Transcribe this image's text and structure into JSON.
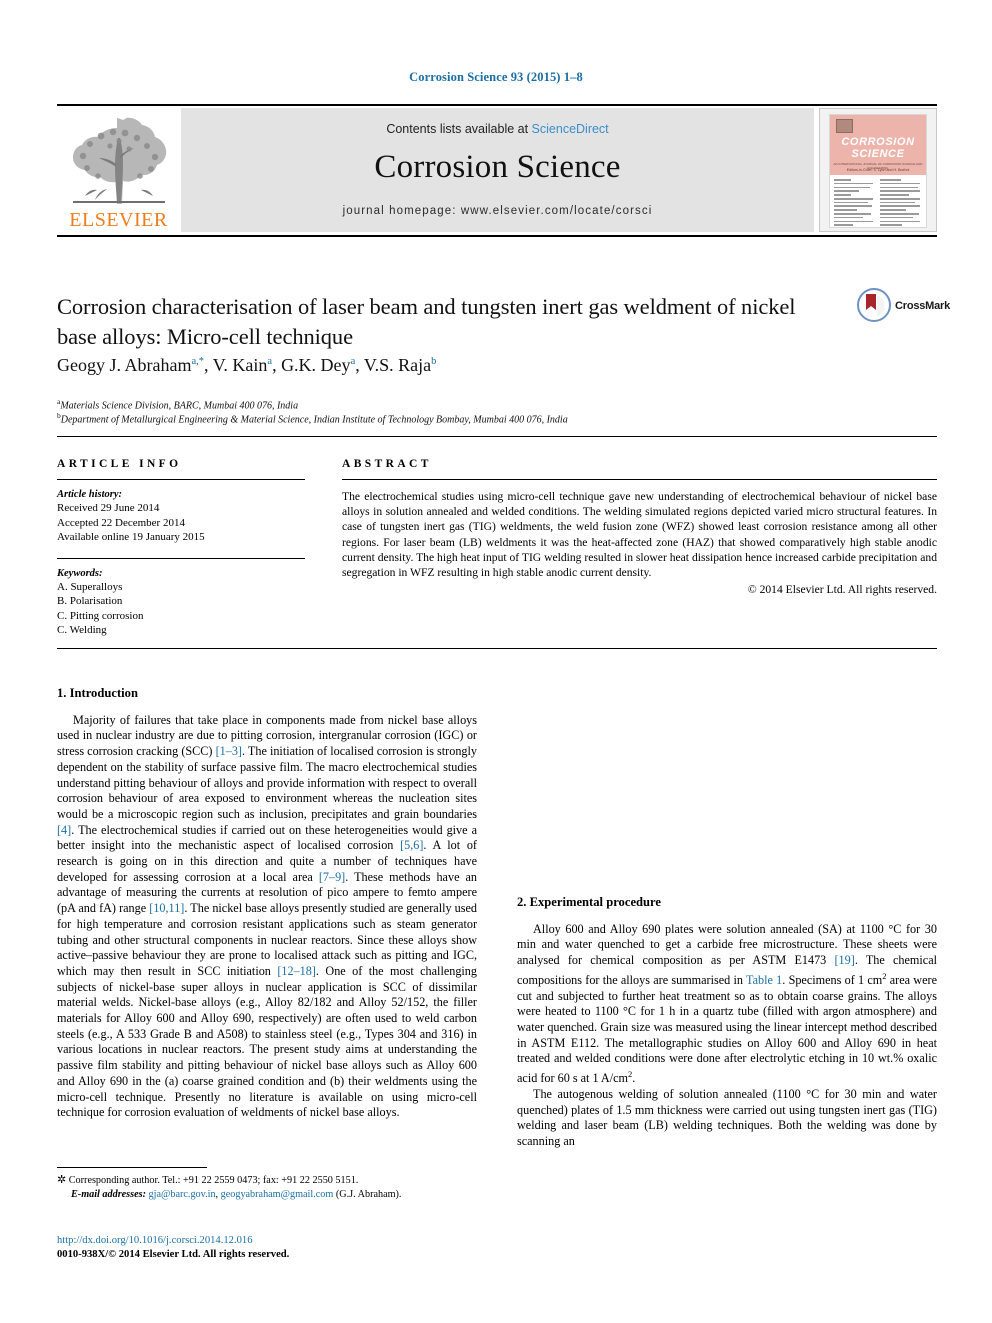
{
  "running_head": "Corrosion Science 93 (2015) 1–8",
  "masthead": {
    "publisher_name": "ELSEVIER",
    "contents_prefix": "Contents lists available at ",
    "contents_link": "ScienceDirect",
    "journal_title": "Corrosion Science",
    "homepage": "journal homepage: www.elsevier.com/locate/corsci",
    "cover": {
      "line1": "CORROSION",
      "line2": "SCIENCE",
      "subtitle": "AN INTERNATIONAL JOURNAL OF CORROSION SCIENCE AND ENGINEERING",
      "editors": "Editors-in-Chief: S. Lyon and H. Boehni"
    }
  },
  "badge": {
    "crossmark_label": "CrossMark"
  },
  "article": {
    "title": "Corrosion characterisation of laser beam and tungsten inert gas weldment of nickel base alloys: Micro-cell technique",
    "authors": [
      {
        "name": "Geogy J. Abraham",
        "marks": "a,*"
      },
      {
        "name": "V. Kain",
        "marks": "a"
      },
      {
        "name": "G.K. Dey",
        "marks": "a"
      },
      {
        "name": "V.S. Raja",
        "marks": "b"
      }
    ],
    "affiliations": [
      {
        "mark": "a",
        "text": "Materials Science Division, BARC, Mumbai 400 076, India"
      },
      {
        "mark": "b",
        "text": "Department of Metallurgical Engineering & Material Science, Indian Institute of Technology Bombay, Mumbai 400 076, India"
      }
    ]
  },
  "article_info": {
    "heading": "ARTICLE INFO",
    "history_label": "Article history:",
    "history": [
      "Received 29 June 2014",
      "Accepted 22 December 2014",
      "Available online 19 January 2015"
    ],
    "keywords_label": "Keywords:",
    "keywords": [
      "A. Superalloys",
      "B. Polarisation",
      "C. Pitting corrosion",
      "C. Welding"
    ]
  },
  "abstract": {
    "heading": "ABSTRACT",
    "text": "The electrochemical studies using micro-cell technique gave new understanding of electrochemical behaviour of nickel base alloys in solution annealed and welded conditions. The welding simulated regions depicted varied micro structural features. In case of tungsten inert gas (TIG) weldments, the weld fusion zone (WFZ) showed least corrosion resistance among all other regions. For laser beam (LB) weldments it was the heat-affected zone (HAZ) that showed comparatively high stable anodic current density. The high heat input of TIG welding resulted in slower heat dissipation hence increased carbide precipitation and segregation in WFZ resulting in high stable anodic current density.",
    "copyright": "© 2014 Elsevier Ltd. All rights reserved."
  },
  "sections": {
    "intro_heading": "1. Introduction",
    "intro_p1_part1": "Majority of failures that take place in components made from nickel base alloys used in nuclear industry are due to pitting corrosion, intergranular corrosion (IGC) or stress corrosion cracking (SCC) ",
    "intro_ref1": "[1–3]",
    "intro_p1_part2": ". The initiation of localised corrosion is strongly dependent on the stability of surface passive film. The macro electrochemical studies understand pitting behaviour of alloys and provide information with respect to overall corrosion behaviour of area exposed to environment whereas the nucleation sites would be a microscopic region such as inclusion, precipitates and grain boundaries ",
    "intro_ref2": "[4]",
    "intro_p1_part3": ". The electrochemical studies if carried out on these heterogeneities would give a better insight into the mechanistic aspect of localised corrosion ",
    "intro_ref3": "[5,6]",
    "intro_p1_part4": ". A lot of research is going on in this direction and quite a number of techniques have developed for assessing corrosion at a local area ",
    "intro_ref4": "[7–9]",
    "intro_p1_part5": ". These methods have an advantage of measuring the currents at resolution of pico ampere to femto ampere (pA and fA) range ",
    "intro_ref5": "[10,11]",
    "intro_p1_part6": ". The nickel base alloys presently studied are generally used for high temperature and corrosion resistant applications such as steam generator tubing and other structural components in nuclear reactors. Since these alloys show active–passive behaviour they are prone to localised attack such as pitting and IGC, which may then result in SCC initiation ",
    "intro_ref6": "[12–18]",
    "intro_p1_part7": ". One of the most challenging subjects of nickel-base super alloys in nuclear application is SCC of dissimilar material welds. Nickel-base alloys (e.g., Alloy 82/182 and Alloy 52/152, the filler materials for Alloy 600 and Alloy 690, respectively) are often used to weld carbon steels (e.g., A 533 Grade B and A508) to stainless steel (e.g., Types 304 and 316) in various locations in nuclear reactors. The present study aims at understanding the passive film stability and pitting behaviour of nickel base alloys such as Alloy 600 and Alloy 690 in the (a) coarse grained condition and (b) their weldments using the micro-cell technique. Presently no literature is available on using micro-cell technique for corrosion evaluation of weldments of nickel base alloys.",
    "exp_heading": "2. Experimental procedure",
    "exp_p1_part1": "Alloy 600 and Alloy 690 plates were solution annealed (SA) at 1100 °C for 30 min and water quenched to get a carbide free microstructure. These sheets were analysed for chemical composition as per ASTM E1473 ",
    "exp_ref1": "[19]",
    "exp_p1_part2": ". The chemical compositions for the alloys are summarised in ",
    "exp_link_table": "Table 1",
    "exp_p1_part3": ". Specimens of 1 cm",
    "exp_sup1": "2",
    "exp_p1_part4": " area were cut and subjected to further heat treatment so as to obtain coarse grains. The alloys were heated to 1100 °C for 1 h in a quartz tube (filled with argon atmosphere) and water quenched. Grain size was measured using the linear intercept method described in ASTM E112. The metallographic studies on Alloy 600 and Alloy 690 in heat treated and welded conditions were done after electrolytic etching in 10 wt.% oxalic acid for 60 s at 1 A/cm",
    "exp_sup2": "2",
    "exp_p1_part5": ".",
    "exp_p2": "The autogenous welding of solution annealed (1100 °C for 30 min and water quenched) plates of 1.5 mm thickness were carried out using tungsten inert gas (TIG) welding and laser beam (LB) welding techniques. Both the welding was done by scanning an"
  },
  "footnote": {
    "corresponding": "Corresponding author. Tel.: +91 22 2559 0473; fax: +91 22 2550 5151.",
    "email_label": "E-mail addresses:",
    "email1": "gja@barc.gov.in",
    "email2": "geogyabraham@gmail.com",
    "email_suffix": "(G.J. Abraham)."
  },
  "doi_block": {
    "doi": "http://dx.doi.org/10.1016/j.corsci.2014.12.016",
    "issn": "0010-938X/© 2014 Elsevier Ltd. All rights reserved."
  },
  "colors": {
    "link_blue": "#1a6fa3",
    "sciencedirect_blue": "#3a8fc8",
    "elsevier_orange": "#ef7d1a",
    "band_grey": "#e3e3e3",
    "cover_pink": "#edb4ac"
  }
}
